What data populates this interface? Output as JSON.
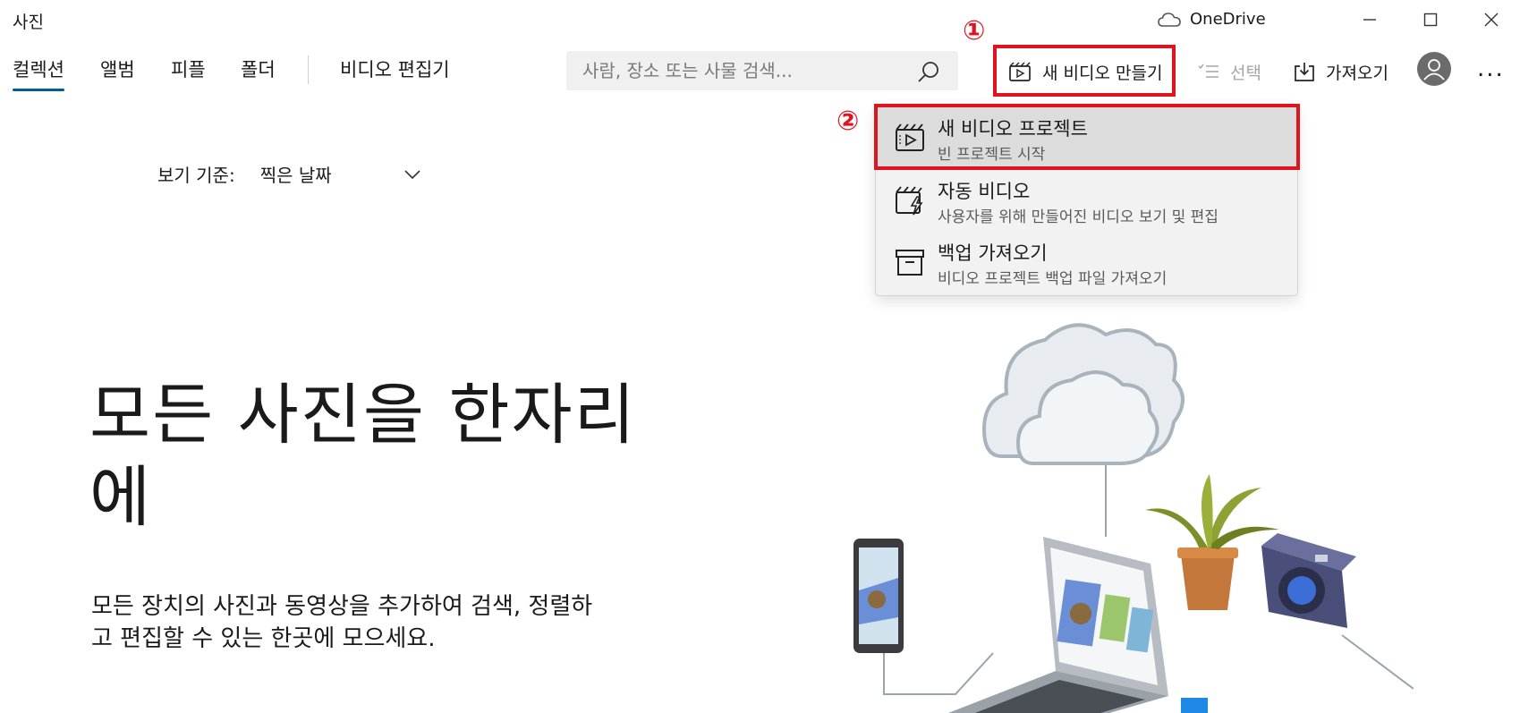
{
  "app": {
    "title": "사진",
    "onedrive_label": "OneDrive"
  },
  "window_controls": {
    "minimize": "minimize-icon",
    "maximize": "maximize-icon",
    "close": "close-icon"
  },
  "nav": {
    "items": [
      {
        "label": "컬렉션",
        "active": true
      },
      {
        "label": "앨범",
        "active": false
      },
      {
        "label": "피플",
        "active": false
      },
      {
        "label": "폴더",
        "active": false
      }
    ],
    "video_editor": "비디오 편집기"
  },
  "search": {
    "placeholder": "사람, 장소 또는 사물 검색..."
  },
  "toolbar": {
    "new_video": "새 비디오 만들기",
    "select": "선택",
    "import": "가져오기",
    "more": "..."
  },
  "annotations": {
    "step1": "①",
    "step2": "②",
    "highlight_color": "#e0141e"
  },
  "dropdown": {
    "items": [
      {
        "title": "새 비디오 프로젝트",
        "subtitle": "빈 프로젝트 시작",
        "icon": "video-project-icon",
        "selected": true
      },
      {
        "title": "자동 비디오",
        "subtitle": "사용자를 위해 만들어진 비디오 보기 및 편집",
        "icon": "auto-video-icon",
        "selected": false
      },
      {
        "title": "백업 가져오기",
        "subtitle": "비디오 프로젝트 백업 파일 가져오기",
        "icon": "archive-icon",
        "selected": false
      }
    ]
  },
  "view_by": {
    "label": "보기 기준:",
    "value": "찍은 날짜"
  },
  "hero": {
    "title_line1": "모든 사진을 한자리",
    "title_line2": "에",
    "description_line1": "모든 장치의 사진과 동영상을 추가하여 검색, 정렬하",
    "description_line2": "고 편집할 수 있는 한곳에 모으세요."
  },
  "colors": {
    "accent": "#005a9e",
    "highlight": "#e0141e"
  }
}
